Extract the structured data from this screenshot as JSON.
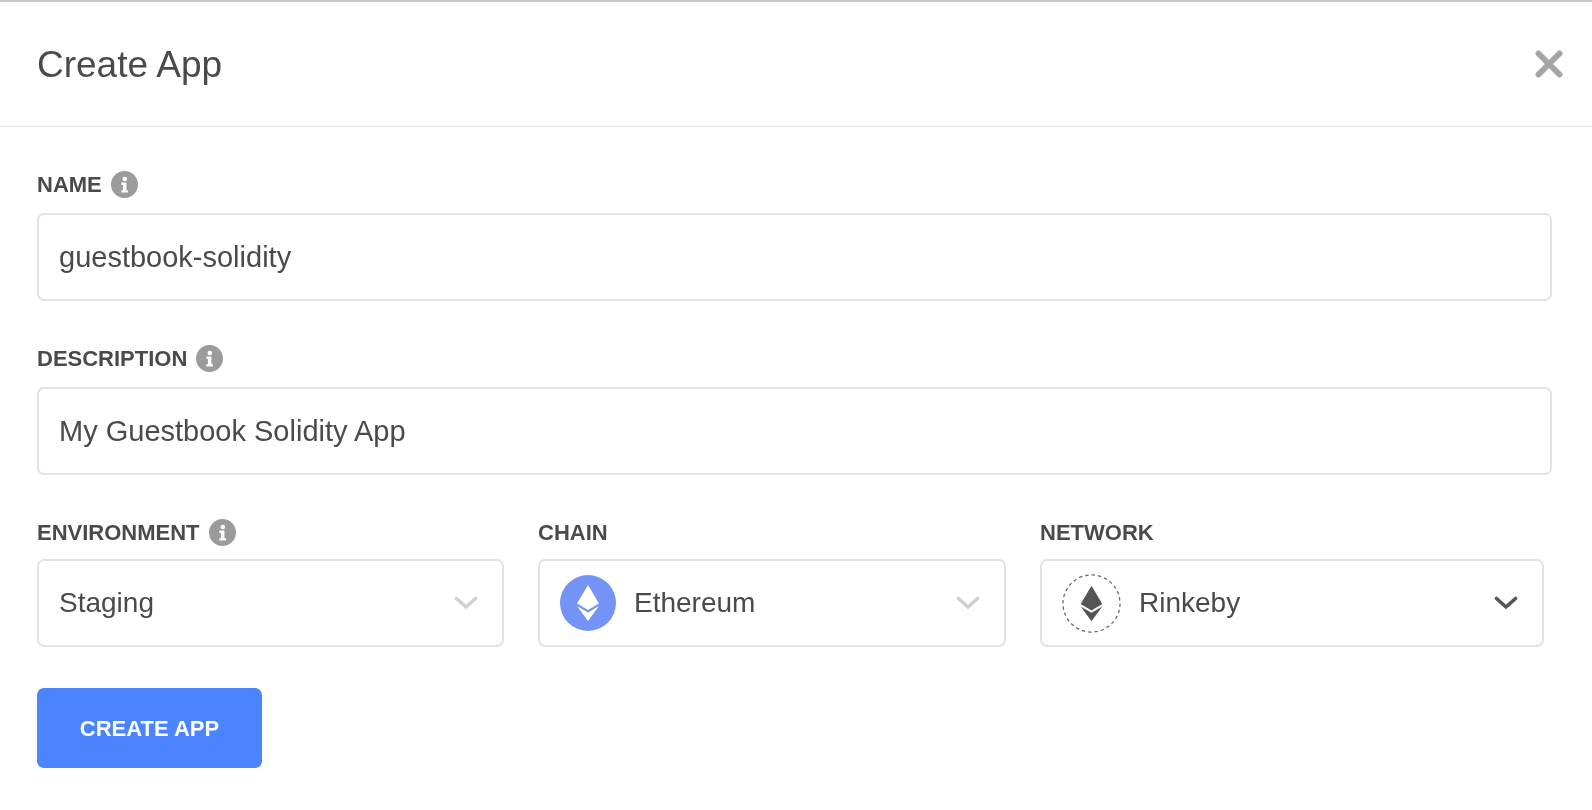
{
  "dialog": {
    "title": "Create App"
  },
  "fields": [
    {
      "label": "NAME",
      "info": true,
      "value": "guestbook-solidity"
    },
    {
      "label": "DESCRIPTION",
      "info": true,
      "value": "My Guestbook Solidity App"
    }
  ],
  "selects": [
    {
      "kind": "plain",
      "label": "ENVIRONMENT",
      "info": true,
      "value": "Staging",
      "disabled": true
    },
    {
      "kind": "chain",
      "label": "CHAIN",
      "info": false,
      "value": "Ethereum",
      "disabled": true
    },
    {
      "kind": "network",
      "label": "NETWORK",
      "info": false,
      "value": "Rinkeby",
      "disabled": false
    }
  ],
  "button": {
    "label": "CREATE APP"
  }
}
